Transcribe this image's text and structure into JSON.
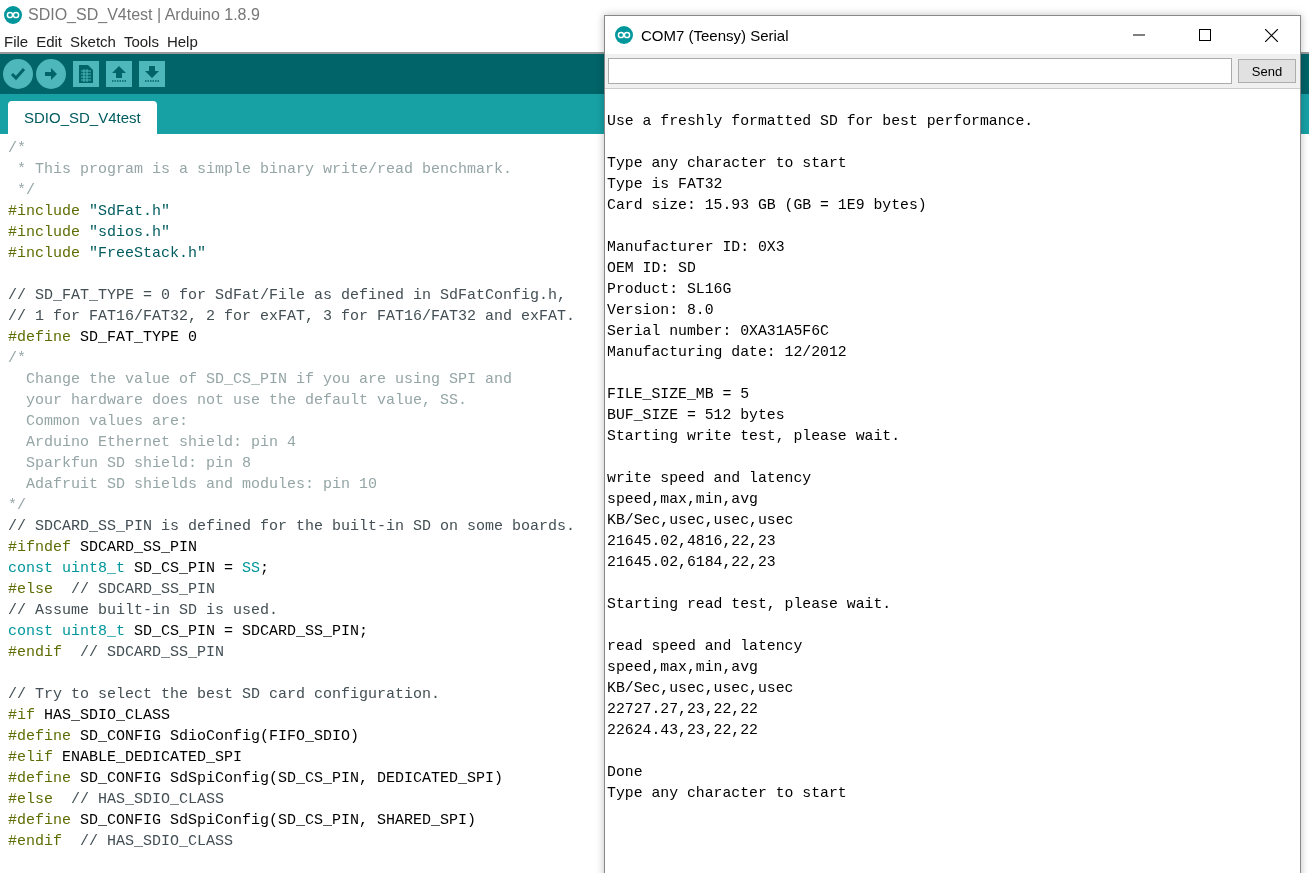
{
  "window": {
    "title": "SDIO_SD_V4test | Arduino 1.8.9"
  },
  "menu": [
    "File",
    "Edit",
    "Sketch",
    "Tools",
    "Help"
  ],
  "tabs": [
    {
      "label": "SDIO_SD_V4test",
      "selected": true
    }
  ],
  "editor": {
    "blocks": [
      [
        [
          {
            "kind": "block_comment",
            "text": "/*"
          }
        ],
        [
          {
            "kind": "block_comment",
            "text": " * This program is a simple binary write/read benchmark."
          }
        ],
        [
          {
            "kind": "block_comment",
            "text": " */"
          }
        ],
        [
          {
            "kind": "directive",
            "text": "#include"
          },
          {
            "kind": "string",
            "text": " \"SdFat.h\""
          }
        ],
        [
          {
            "kind": "directive",
            "text": "#include"
          },
          {
            "kind": "string",
            "text": " \"sdios.h\""
          }
        ],
        [
          {
            "kind": "directive",
            "text": "#include"
          },
          {
            "kind": "string",
            "text": " \"FreeStack.h\""
          }
        ]
      ],
      [
        [
          {
            "kind": "line_comment",
            "text": "// SD_FAT_TYPE = 0 for SdFat/File as defined in SdFatConfig.h,"
          }
        ],
        [
          {
            "kind": "line_comment",
            "text": "// 1 for FAT16/FAT32, 2 for exFAT, 3 for FAT16/FAT32 and exFAT."
          }
        ],
        [
          {
            "kind": "directive",
            "text": "#define"
          },
          {
            "kind": "plain",
            "text": " SD_FAT_TYPE 0"
          }
        ],
        [
          {
            "kind": "block_comment",
            "text": "/*"
          }
        ],
        [
          {
            "kind": "block_comment",
            "text": "  Change the value of SD_CS_PIN if you are using SPI and"
          }
        ],
        [
          {
            "kind": "block_comment",
            "text": "  your hardware does not use the default value, SS."
          }
        ],
        [
          {
            "kind": "block_comment",
            "text": "  Common values are:"
          }
        ],
        [
          {
            "kind": "block_comment",
            "text": "  Arduino Ethernet shield: pin 4"
          }
        ],
        [
          {
            "kind": "block_comment",
            "text": "  Sparkfun SD shield: pin 8"
          }
        ],
        [
          {
            "kind": "block_comment",
            "text": "  Adafruit SD shields and modules: pin 10"
          }
        ],
        [
          {
            "kind": "block_comment",
            "text": "*/"
          }
        ],
        [
          {
            "kind": "line_comment",
            "text": "// SDCARD_SS_PIN is defined for the built-in SD on some boards."
          }
        ],
        [
          {
            "kind": "directive",
            "text": "#ifndef"
          },
          {
            "kind": "plain",
            "text": " SDCARD_SS_PIN"
          }
        ],
        [
          {
            "kind": "type",
            "text": "const uint8_t"
          },
          {
            "kind": "plain",
            "text": " SD_CS_PIN = "
          },
          {
            "kind": "type",
            "text": "SS"
          },
          {
            "kind": "plain",
            "text": ";"
          }
        ],
        [
          {
            "kind": "directive",
            "text": "#else"
          },
          {
            "kind": "line_comment",
            "text": "  // SDCARD_SS_PIN"
          }
        ],
        [
          {
            "kind": "line_comment",
            "text": "// Assume built-in SD is used."
          }
        ],
        [
          {
            "kind": "type",
            "text": "const uint8_t"
          },
          {
            "kind": "plain",
            "text": " SD_CS_PIN = SDCARD_SS_PIN;"
          }
        ],
        [
          {
            "kind": "directive",
            "text": "#endif"
          },
          {
            "kind": "line_comment",
            "text": "  // SDCARD_SS_PIN"
          }
        ]
      ],
      [
        [
          {
            "kind": "line_comment",
            "text": "// Try to select the best SD card configuration."
          }
        ],
        [
          {
            "kind": "directive",
            "text": "#if"
          },
          {
            "kind": "plain",
            "text": " HAS_SDIO_CLASS"
          }
        ],
        [
          {
            "kind": "directive",
            "text": "#define"
          },
          {
            "kind": "plain",
            "text": " SD_CONFIG SdioConfig(FIFO_SDIO)"
          }
        ],
        [
          {
            "kind": "directive",
            "text": "#elif"
          },
          {
            "kind": "plain",
            "text": " ENABLE_DEDICATED_SPI"
          }
        ],
        [
          {
            "kind": "directive",
            "text": "#define"
          },
          {
            "kind": "plain",
            "text": " SD_CONFIG SdSpiConfig(SD_CS_PIN, DEDICATED_SPI)"
          }
        ],
        [
          {
            "kind": "directive",
            "text": "#else"
          },
          {
            "kind": "line_comment",
            "text": "  // HAS_SDIO_CLASS"
          }
        ],
        [
          {
            "kind": "directive",
            "text": "#define"
          },
          {
            "kind": "plain",
            "text": " SD_CONFIG SdSpiConfig(SD_CS_PIN, SHARED_SPI)"
          }
        ],
        [
          {
            "kind": "directive",
            "text": "#endif"
          },
          {
            "kind": "line_comment",
            "text": "  // HAS_SDIO_CLASS"
          }
        ]
      ]
    ]
  },
  "serial_monitor": {
    "title": "COM7 (Teensy) Serial",
    "send_button": "Send",
    "output_blocks": [
      [
        "Use a freshly formatted SD for best performance."
      ],
      [
        "Type any character to start",
        "Type is FAT32",
        "Card size: 15.93 GB (GB = 1E9 bytes)"
      ],
      [
        "Manufacturer ID: 0X3",
        "OEM ID: SD",
        "Product: SL16G",
        "Version: 8.0",
        "Serial number: 0XA31A5F6C",
        "Manufacturing date: 12/2012"
      ],
      [
        "FILE_SIZE_MB = 5",
        "BUF_SIZE = 512 bytes",
        "Starting write test, please wait."
      ],
      [
        "write speed and latency",
        "speed,max,min,avg",
        "KB/Sec,usec,usec,usec",
        "21645.02,4816,22,23",
        "21645.02,6184,22,23"
      ],
      [
        "Starting read test, please wait."
      ],
      [
        "read speed and latency",
        "speed,max,min,avg",
        "KB/Sec,usec,usec,usec",
        "22727.27,23,22,22",
        "22624.43,23,22,22"
      ],
      [
        "Done",
        "Type any character to start"
      ]
    ]
  }
}
